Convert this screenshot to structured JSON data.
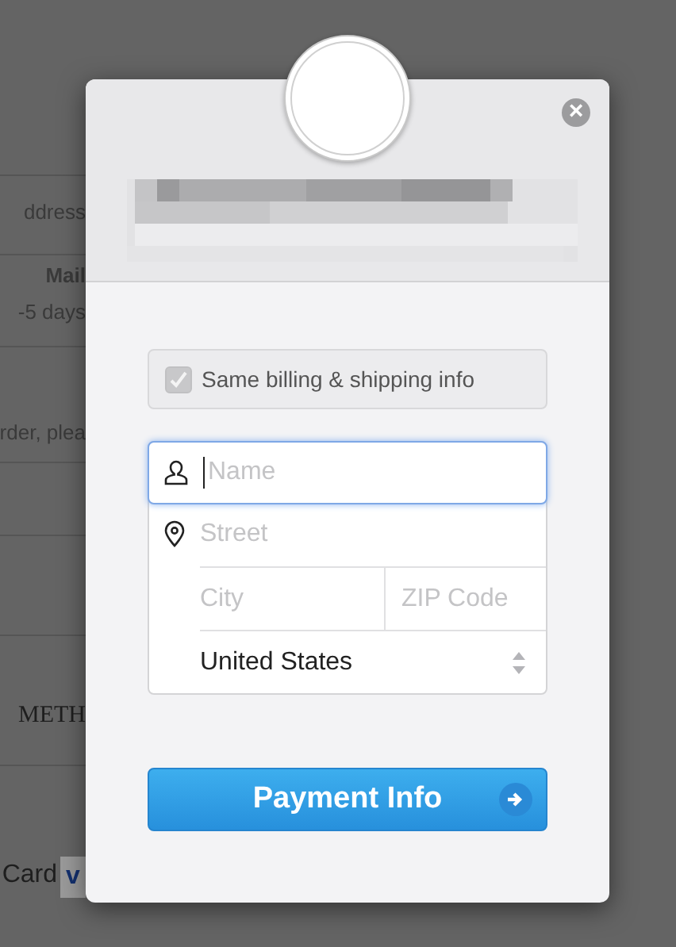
{
  "background": {
    "lines": [
      {
        "text": "ddress",
        "kind": "plain"
      },
      {
        "text": "Mail",
        "kind": "bold"
      },
      {
        "text": "-5 days",
        "kind": "plain"
      },
      {
        "text": "rder, plea",
        "kind": "plain"
      },
      {
        "text": "METH",
        "kind": "serif"
      },
      {
        "text": "Card",
        "kind": "large"
      }
    ],
    "card_badge": "v"
  },
  "dialog": {
    "close": "×",
    "same_billing": {
      "label": "Same billing & shipping info",
      "checked": true
    },
    "fields": {
      "name": {
        "placeholder": "Name",
        "focused": true
      },
      "street": {
        "placeholder": "Street"
      },
      "city": {
        "placeholder": "City"
      },
      "zip": {
        "placeholder": "ZIP Code"
      },
      "country": {
        "value": "United States"
      }
    },
    "button": {
      "label": "Payment Info"
    }
  }
}
